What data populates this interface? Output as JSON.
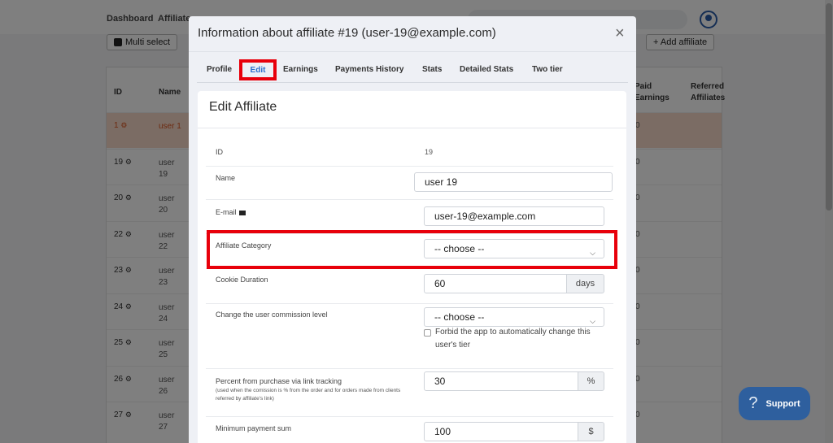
{
  "background": {
    "nav": {
      "dashboard": "Dashboard",
      "affiliates": "Affiliates"
    },
    "buttons": {
      "multi_select": "Multi select",
      "add_affiliate": "+ Add affiliate"
    },
    "columns": {
      "id": "ID",
      "name": "Name",
      "paid_earnings_1": "Paid",
      "paid_earnings_2": "Earnings",
      "referred_1": "Referred",
      "referred_2": "Affiliates"
    },
    "rows": [
      {
        "id": "1",
        "name": "user 1",
        "val": "0",
        "highlight": true
      },
      {
        "id": "19",
        "name": "user 19",
        "val": "0"
      },
      {
        "id": "20",
        "name": "user 20",
        "val": "0"
      },
      {
        "id": "22",
        "name": "user 22",
        "val": "0"
      },
      {
        "id": "23",
        "name": "user 23",
        "val": "0"
      },
      {
        "id": "24",
        "name": "user 24",
        "val": "0"
      },
      {
        "id": "25",
        "name": "user 25",
        "val": "0"
      },
      {
        "id": "26",
        "name": "user 26",
        "val": "0"
      },
      {
        "id": "27",
        "name": "user 27",
        "val": "0"
      }
    ]
  },
  "modal": {
    "title": "Information about affiliate #19 (user-19@example.com)",
    "close_icon": "×",
    "tabs": [
      "Profile",
      "Edit",
      "Earnings",
      "Payments History",
      "Stats",
      "Detailed Stats",
      "Two tier"
    ],
    "active_tab": "Edit",
    "panel_title": "Edit Affiliate",
    "fields": {
      "id_label": "ID",
      "id_value": "19",
      "name_label": "Name",
      "name_value": "user 19",
      "email_label": "E-mail",
      "email_value": "user-19@example.com",
      "category_label": "Affiliate Category",
      "category_value": "-- choose --",
      "cookie_label": "Cookie Duration",
      "cookie_value": "60",
      "cookie_unit": "days",
      "commission_label": "Change the user commission level",
      "commission_value": "-- choose --",
      "forbid_label": "Forbid the app to automatically change this user's tier",
      "percent_label": "Percent from purchase via link tracking",
      "percent_note": "(used when the comission is % from the order and for orders made from clients referred by affiliate's link)",
      "percent_value": "30",
      "percent_unit": "%",
      "minpay_label": "Minimum payment sum",
      "minpay_value": "100",
      "minpay_unit": "$"
    }
  },
  "support": {
    "label": "Support",
    "icon": "?"
  },
  "colors": {
    "highlight": "#e8000b",
    "accent": "#2b6fcc",
    "support_bg": "#2e5f9e"
  }
}
